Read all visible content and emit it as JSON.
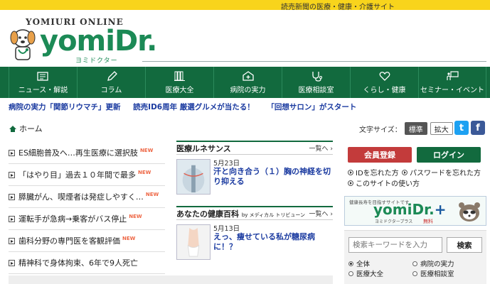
{
  "topbar": {
    "tagline": "読売新聞の医療・健康・介護サイト"
  },
  "logo": {
    "brand_top": "YOMIURI ONLINE",
    "brand": "yomiDr.",
    "brand_sub": "ヨミドクター"
  },
  "nav": [
    {
      "label": "ニュース・解説"
    },
    {
      "label": "コラム"
    },
    {
      "label": "医療大全"
    },
    {
      "label": "病院の実力"
    },
    {
      "label": "医療相談室"
    },
    {
      "label": "くらし・健康"
    },
    {
      "label": "セミナー・イベント"
    }
  ],
  "ticker": [
    "病院の実力「関節リウマチ」更新",
    "読売ID6周年 厳選グルメが当たる！",
    "「回想サロン」がスタート"
  ],
  "breadcrumb": {
    "home": "ホーム"
  },
  "fontsize": {
    "label": "文字サイズ：",
    "standard": "標準",
    "large": "拡大"
  },
  "social": {
    "twitter": "t",
    "facebook": "f"
  },
  "news_list": [
    {
      "text": "ES細胞普及へ…再生医療に選択肢",
      "new": "NEW"
    },
    {
      "text": "「はやり目」過去１０年間で最多",
      "new": "NEW"
    },
    {
      "text": "膵臓がん、喫煙者は発症しやすく…",
      "new": "NEW"
    },
    {
      "text": "運転手が急病→乗客がバス停止",
      "new": "NEW"
    },
    {
      "text": "歯科分野の専門医を客観評価",
      "new": "NEW"
    },
    {
      "text": "精神科で身体拘束、6年で9人死亡",
      "new": ""
    }
  ],
  "sections": [
    {
      "title": "医療ルネサンス",
      "sponsor": "",
      "more": "一覧へ ›",
      "date": "5月23日",
      "headline": "汗と向き合う（１）胸の神経を切り抑える"
    },
    {
      "title": "あなたの健康百科",
      "sponsor": "by メディカル トリビューン",
      "more": "一覧へ ›",
      "date": "5月13日",
      "headline": "えっ、痩せている私が糖尿病に！？"
    }
  ],
  "account": {
    "register": "会員登録",
    "login": "ログイン",
    "forgot_id": "IDを忘れた方",
    "forgot_password": "パスワードを忘れた方",
    "how_to_use": "このサイトの使い方"
  },
  "plus_banner": {
    "small": "健康長寿を目指すサイトです",
    "brand": "yomiDr.",
    "plus": "+",
    "sub": "ヨミドクタープラス",
    "free": "無料"
  },
  "search": {
    "placeholder": "検索キーワードを入力",
    "button": "検索",
    "options": [
      "全体",
      "病院の実力",
      "医療大全",
      "医療相談室"
    ],
    "selected": "全体"
  },
  "colors": {
    "brand_green": "#126a3e",
    "banner_yellow": "#f8d41c",
    "link_blue": "#1a3aa0",
    "register_red": "#c33b3b"
  }
}
